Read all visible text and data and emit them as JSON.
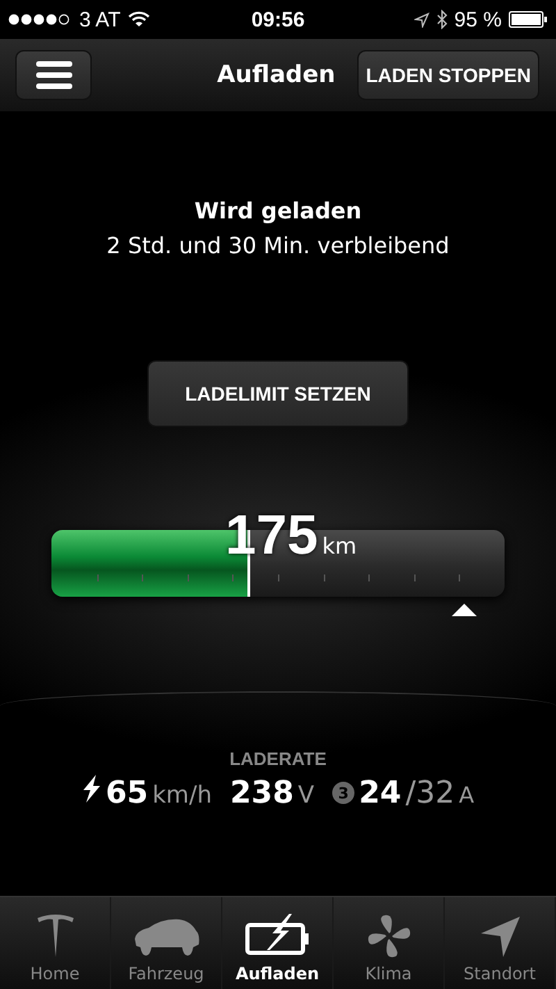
{
  "status_bar": {
    "carrier": "3 AT",
    "time": "09:56",
    "battery": "95 %"
  },
  "nav": {
    "title": "Aufladen",
    "action": "LADEN STOPPEN"
  },
  "charging": {
    "title": "Wird geladen",
    "remaining": "2 Std. und 30 Min. verbleibend"
  },
  "limit_button": "LADELIMIT SETZEN",
  "battery": {
    "range": "175",
    "unit": "km",
    "level": 0.44
  },
  "rate": {
    "label": "LADERATE",
    "speed": "65",
    "speed_unit": "km/h",
    "voltage": "238",
    "voltage_unit": "V",
    "phases": "3",
    "current": "24",
    "current_max": "/32",
    "current_unit": "A"
  },
  "tabs": [
    {
      "label": "Home",
      "kind": "home",
      "selected": false
    },
    {
      "label": "Fahrzeug",
      "kind": "car",
      "selected": false
    },
    {
      "label": "Aufladen",
      "kind": "charge",
      "selected": true
    },
    {
      "label": "Klima",
      "kind": "fan",
      "selected": false
    },
    {
      "label": "Standort",
      "kind": "location",
      "selected": false
    }
  ]
}
